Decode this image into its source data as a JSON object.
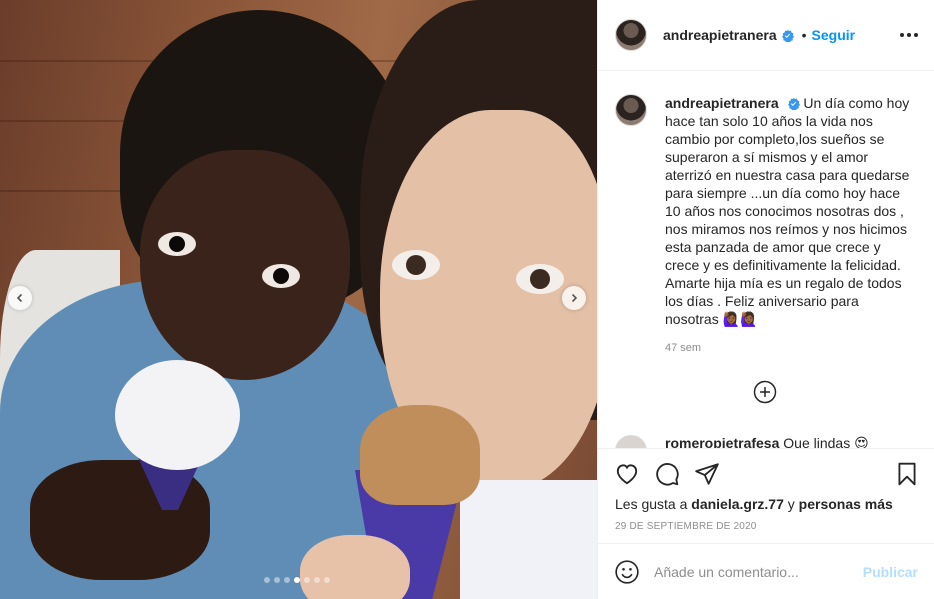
{
  "post": {
    "carousel": {
      "slide_count": 7,
      "active_slide": 3
    },
    "header": {
      "username": "andreapietranera",
      "separator": "•",
      "follow_label": "Seguir"
    },
    "caption": {
      "username": "andreapietranera",
      "text": "Un día como hoy hace tan solo 10 años la vida nos cambio por completo,los sueños se superaron a sí mismos y el amor aterrizó en nuestra casa para quedarse para siempre ...un día como hoy hace 10 años nos conocimos nosotras dos , nos miramos nos reímos y nos hicimos esta panzada de amor que crece y crece y es definitivamente la felicidad. Amarte hija mía es un regalo de todos los días . Feliz aniversario para nosotras 🙋🏾‍♀️🙋🏾‍♀️",
      "age": "47 sem"
    },
    "next_comment": {
      "username": "romeropietrafesa",
      "text": "Que lindas 😍"
    },
    "likes": {
      "prefix": "Les gusta a",
      "user": "daniela.grz.77",
      "connector": "y",
      "others": "personas más"
    },
    "date": "29 DE SEPTIEMBRE DE 2020",
    "comment_box": {
      "placeholder": "Añade un comentario...",
      "publish_label": "Publicar"
    },
    "colors": {
      "accent": "#0095f6",
      "publish_disabled": "#b3dffc",
      "secondary_text": "#8e8e8e"
    },
    "icons": {
      "like": "heart-icon",
      "comment": "comment-icon",
      "share": "send-icon",
      "save": "bookmark-icon",
      "emoji": "smiley-icon",
      "load_more": "plus-circle-icon",
      "verified": "verified-badge-icon",
      "more": "more-options-icon"
    }
  }
}
